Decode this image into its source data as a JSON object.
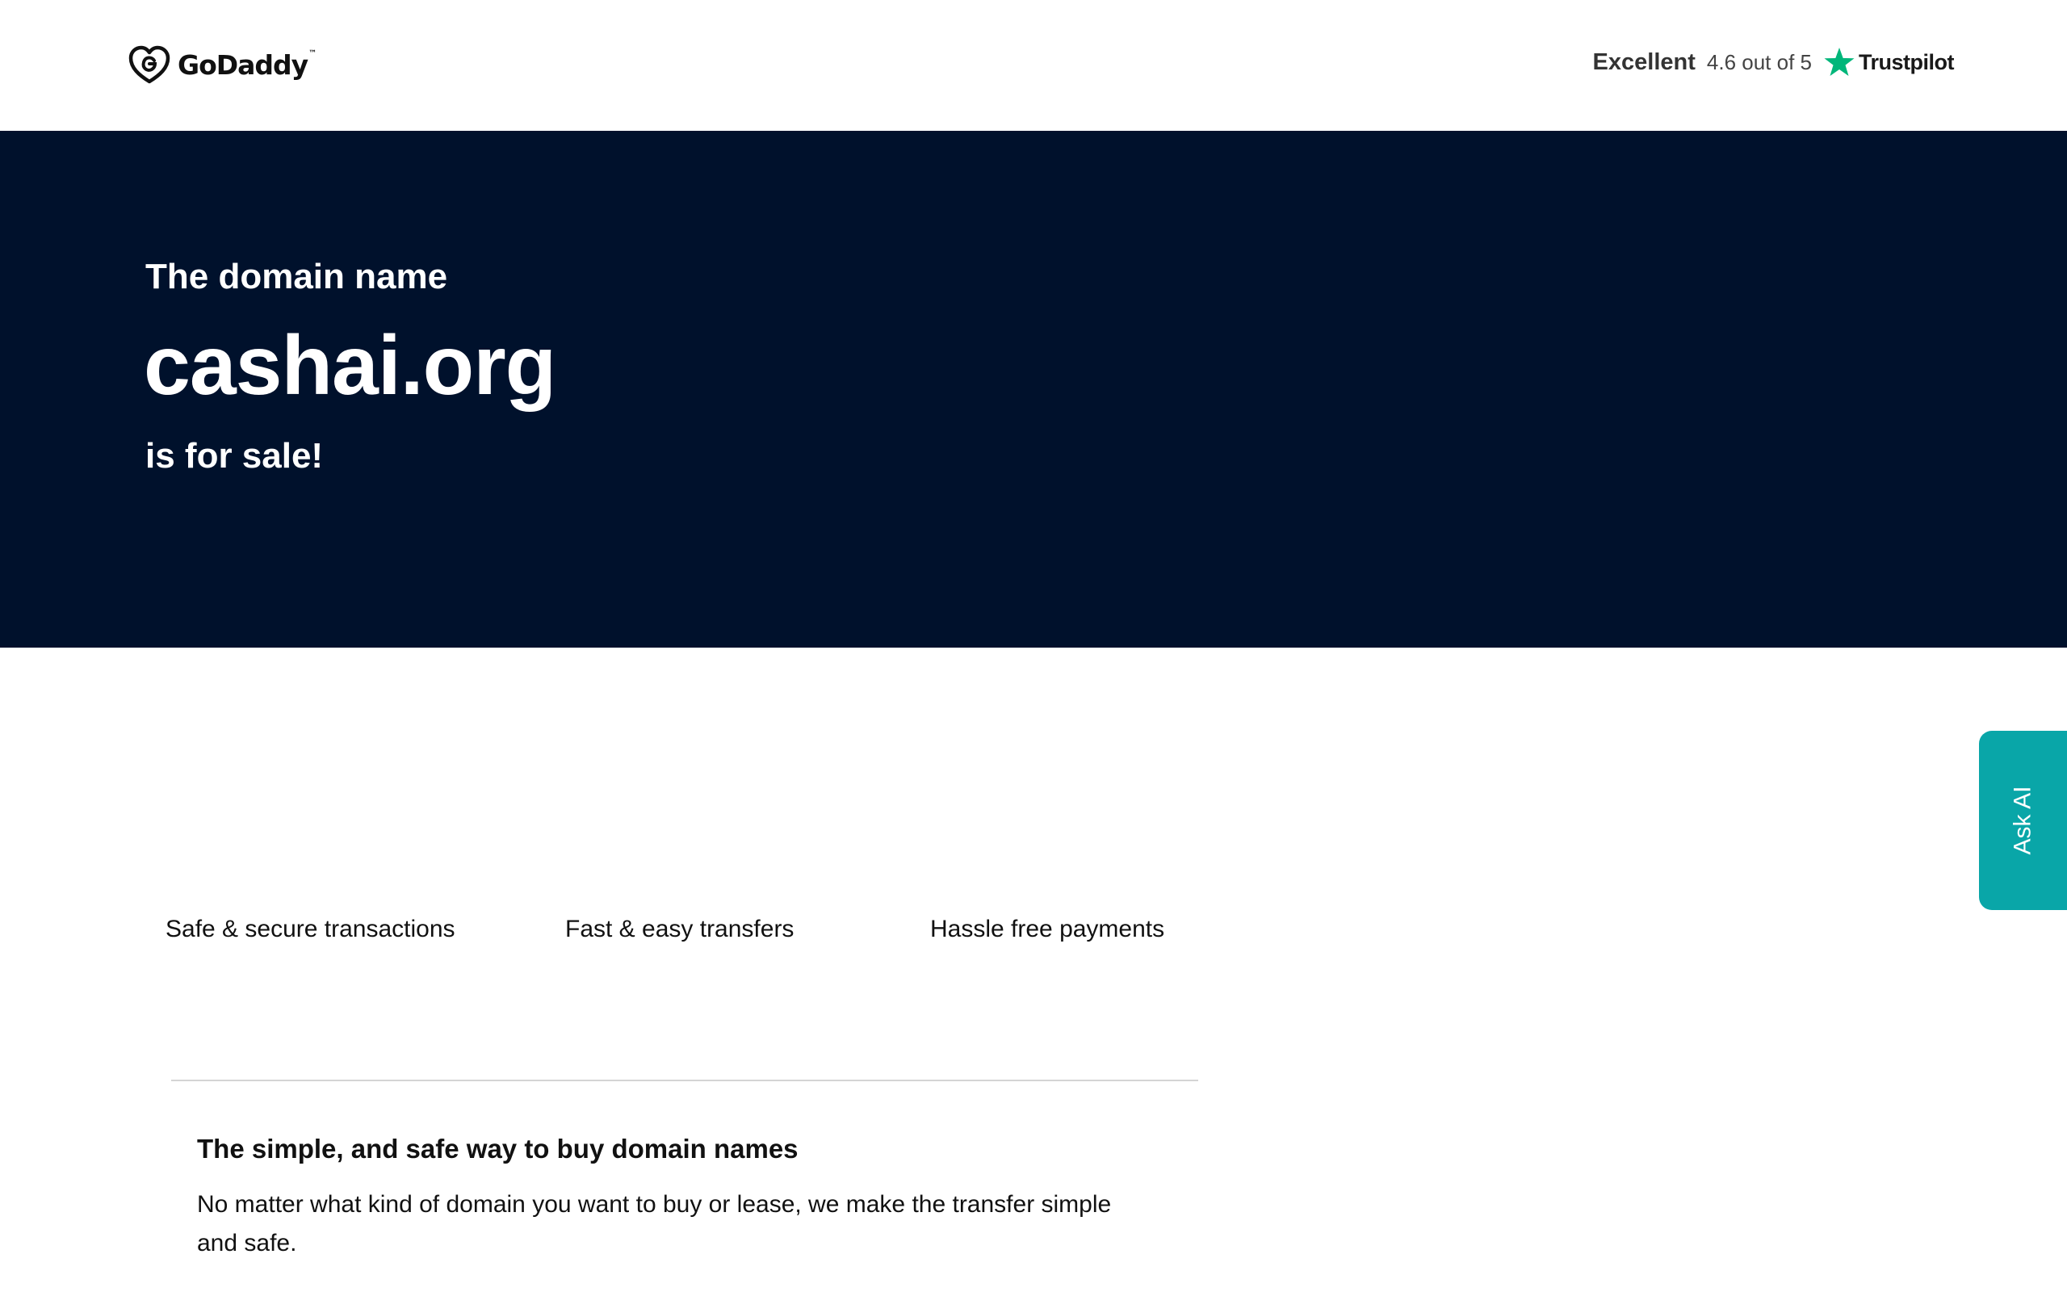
{
  "header": {
    "logo_text": "GoDaddy",
    "logo_tm": "™",
    "trustpilot": {
      "rating_word": "Excellent",
      "score_text": "4.6 out of 5",
      "brand": "Trustpilot",
      "star_color": "#00b67a"
    }
  },
  "hero": {
    "pre": "The domain name",
    "domain": "cashai.org",
    "post": "is for sale!",
    "background": "#00112c"
  },
  "features": [
    "Safe & secure transactions",
    "Fast & easy transfers",
    "Hassle free payments"
  ],
  "info": {
    "title": "The simple, and safe way to buy domain names",
    "body": "No matter what kind of domain you want to buy or lease, we make the transfer simple and safe."
  },
  "ask_ai": {
    "label": "Ask AI",
    "color": "#09a6a8"
  }
}
